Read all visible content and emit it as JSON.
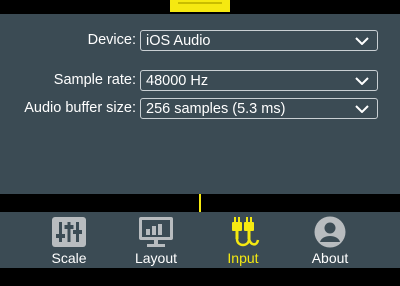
{
  "settings": {
    "device": {
      "label": "Device:",
      "value": "iOS Audio"
    },
    "sample_rate": {
      "label": "Sample rate:",
      "value": "48000 Hz"
    },
    "buffer_size": {
      "label": "Audio buffer size:",
      "value": "256 samples (5.3 ms)"
    }
  },
  "tabs": [
    {
      "label": "Scale",
      "icon": "sliders-icon",
      "active": false
    },
    {
      "label": "Layout",
      "icon": "monitor-chart-icon",
      "active": false
    },
    {
      "label": "Input",
      "icon": "audio-cable-icon",
      "active": true
    },
    {
      "label": "About",
      "icon": "person-icon",
      "active": false
    }
  ],
  "colors": {
    "panel": "#3b4b54",
    "accent": "#f5e911",
    "icon_gray": "#b8bcbf"
  }
}
